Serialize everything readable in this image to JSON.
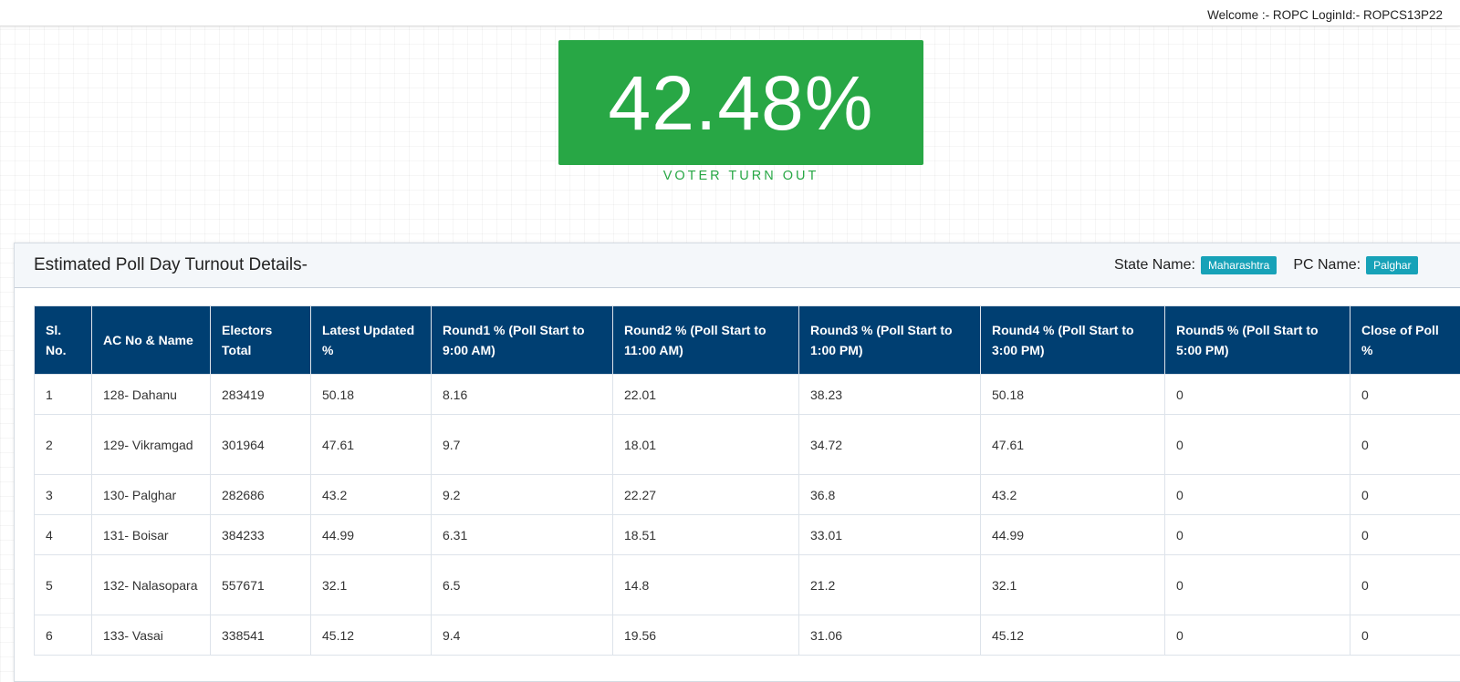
{
  "header": {
    "welcome": "Welcome :- ROPC LoginId:- ROPCS13P22"
  },
  "kpi": {
    "value": "42.48%",
    "label": "VOTER TURN OUT",
    "color": "#28a745"
  },
  "card": {
    "title": "Estimated Poll Day Turnout Details-",
    "state_label": "State Name:",
    "state_value": "Maharashtra",
    "pc_label": "PC Name:",
    "pc_value": "Palghar",
    "badge_color": "#17a2b8"
  },
  "table": {
    "header_color": "#003f72",
    "columns": [
      "Sl. No.",
      "AC No & Name",
      "Electors Total",
      "Latest Updated %",
      "Round1 % (Poll Start to 9:00 AM)",
      "Round2 % (Poll Start to 11:00 AM)",
      "Round3 % (Poll Start to 1:00 PM)",
      "Round4 % (Poll Start to 3:00 PM)",
      "Round5 % (Poll Start to 5:00 PM)",
      "Close of Poll %"
    ],
    "rows": [
      [
        "1",
        "128- Dahanu",
        "283419",
        "50.18",
        "8.16",
        "22.01",
        "38.23",
        "50.18",
        "0",
        "0"
      ],
      [
        "2",
        "129- Vikramgad",
        "301964",
        "47.61",
        "9.7",
        "18.01",
        "34.72",
        "47.61",
        "0",
        "0"
      ],
      [
        "3",
        "130- Palghar",
        "282686",
        "43.2",
        "9.2",
        "22.27",
        "36.8",
        "43.2",
        "0",
        "0"
      ],
      [
        "4",
        "131- Boisar",
        "384233",
        "44.99",
        "6.31",
        "18.51",
        "33.01",
        "44.99",
        "0",
        "0"
      ],
      [
        "5",
        "132- Nalasopara",
        "557671",
        "32.1",
        "6.5",
        "14.8",
        "21.2",
        "32.1",
        "0",
        "0"
      ],
      [
        "6",
        "133- Vasai",
        "338541",
        "45.12",
        "9.4",
        "19.56",
        "31.06",
        "45.12",
        "0",
        "0"
      ]
    ]
  }
}
